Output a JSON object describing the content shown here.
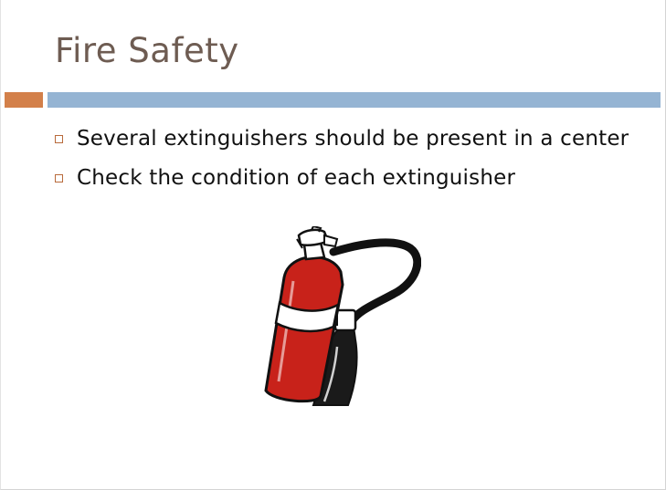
{
  "slide": {
    "title": "Fire Safety",
    "bullets": [
      {
        "text": "Several extinguishers should be present in a center"
      },
      {
        "text": "Check the condition of each extinguisher"
      }
    ],
    "illustration": {
      "icon": "fire-extinguisher-icon"
    }
  },
  "colors": {
    "title": "#6e5c52",
    "accent_bar": "#d3804a",
    "main_bar": "#95b4d3",
    "bullet_marker": "#b86a3b",
    "extinguisher_body": "#c8221a"
  }
}
